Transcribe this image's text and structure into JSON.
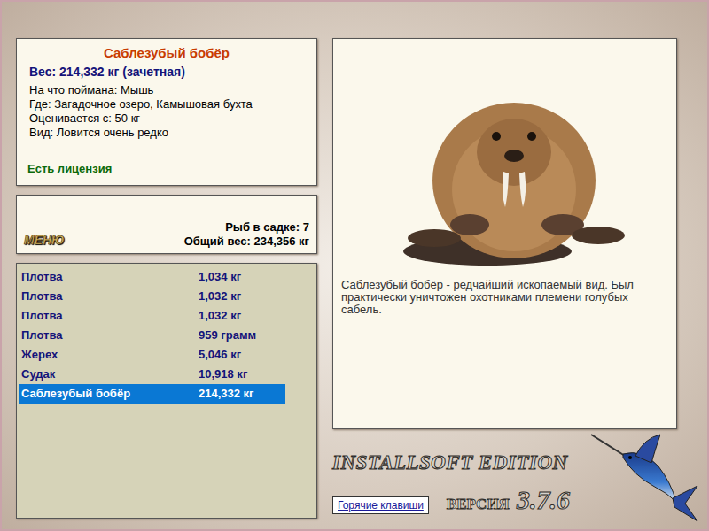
{
  "catch": {
    "title": "Саблезубый бобёр",
    "weight": "Вес: 214,332 кг (зачетная)",
    "details": [
      "На что поймана: Мышь",
      "Где: Загадочное озеро, Камышовая бухта",
      "Оценивается с: 50 кг",
      "Вид: Ловится очень редко"
    ],
    "license": "Есть лицензия"
  },
  "keepnet": {
    "menu_button": "МЕНЮ",
    "count": "Рыб в садке: 7",
    "total": "Общий вес: 234,356 кг"
  },
  "fish_list": [
    {
      "name": "Плотва",
      "weight": "1,034 кг",
      "selected": false
    },
    {
      "name": "Плотва",
      "weight": "1,032 кг",
      "selected": false
    },
    {
      "name": "Плотва",
      "weight": "1,032 кг",
      "selected": false
    },
    {
      "name": "Плотва",
      "weight": "959 грамм",
      "selected": false
    },
    {
      "name": "Жерех",
      "weight": "5,046 кг",
      "selected": false
    },
    {
      "name": "Судак",
      "weight": "10,918 кг",
      "selected": false
    },
    {
      "name": "Саблезубый бобёр",
      "weight": "214,332 кг",
      "selected": true
    }
  ],
  "description": "Саблезубый бобёр - редчайший ископаемый вид. Был практически уничтожен охотниками племени голубых сабель.",
  "branding": {
    "edition": "INSTALLSOFT EDITION",
    "version_label": "ВЕРСИЯ",
    "version": "3.7.6"
  },
  "hotkeys_button": "Горячие клавиши"
}
